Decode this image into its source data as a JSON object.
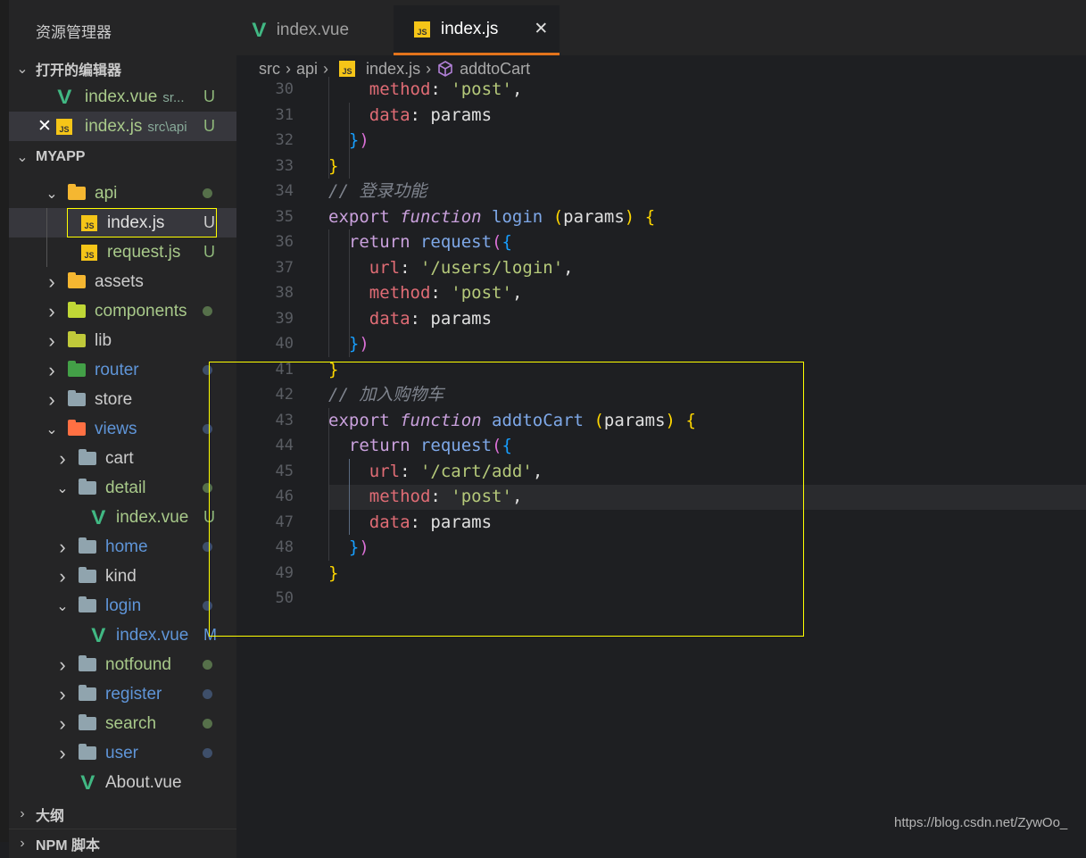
{
  "sidebar": {
    "title": "资源管理器",
    "open_editors_label": "打开的编辑器",
    "open_editors": [
      {
        "name": "index.vue",
        "path": "sr...",
        "status": "U",
        "icon": "vue-icon"
      },
      {
        "name": "index.js",
        "path": "src\\api",
        "status": "U",
        "icon": "js-icon",
        "active": true
      }
    ],
    "project_label": "MYAPP",
    "tree": [
      {
        "name": "api",
        "type": "folder",
        "open": true,
        "depth": 1,
        "color": "#f5b731",
        "text": "#a8c98a",
        "dot": "#56704a"
      },
      {
        "name": "index.js",
        "type": "js",
        "depth": 2,
        "text": "#e0e0e0",
        "status": "U",
        "statusColor": "#ccc",
        "selected": true
      },
      {
        "name": "request.js",
        "type": "js",
        "depth": 2,
        "text": "#a8c98a",
        "status": "U",
        "statusColor": "#8fb87a"
      },
      {
        "name": "assets",
        "type": "folder",
        "depth": 1,
        "color": "#f5b731",
        "text": "#ccc"
      },
      {
        "name": "components",
        "type": "folder",
        "depth": 1,
        "color": "#c0d736",
        "text": "#a8c98a",
        "dot": "#56704a"
      },
      {
        "name": "lib",
        "type": "folder",
        "depth": 1,
        "color": "#c0c93a",
        "text": "#ccc"
      },
      {
        "name": "router",
        "type": "folder",
        "depth": 1,
        "color": "#43a047",
        "text": "#5f95d8",
        "dot": "#3e4f6a"
      },
      {
        "name": "store",
        "type": "folder",
        "depth": 1,
        "color": "#90a4ae",
        "text": "#ccc"
      },
      {
        "name": "views",
        "type": "folder",
        "open": true,
        "depth": 1,
        "color": "#ff7043",
        "text": "#5f95d8",
        "dot": "#3e4f6a"
      },
      {
        "name": "cart",
        "type": "folder",
        "depth": 2,
        "color": "#90a4ae",
        "text": "#ccc"
      },
      {
        "name": "detail",
        "type": "folder",
        "open": true,
        "depth": 2,
        "color": "#90a4ae",
        "text": "#a8c98a",
        "dot": "#56704a"
      },
      {
        "name": "index.vue",
        "type": "vue",
        "depth": 3,
        "text": "#a8c98a",
        "status": "U",
        "statusColor": "#8fb87a"
      },
      {
        "name": "home",
        "type": "folder",
        "depth": 2,
        "color": "#90a4ae",
        "text": "#5f95d8",
        "dot": "#3e4f6a"
      },
      {
        "name": "kind",
        "type": "folder",
        "depth": 2,
        "color": "#90a4ae",
        "text": "#ccc"
      },
      {
        "name": "login",
        "type": "folder",
        "open": true,
        "depth": 2,
        "color": "#90a4ae",
        "text": "#5f95d8",
        "dot": "#3e4f6a"
      },
      {
        "name": "index.vue",
        "type": "vue",
        "depth": 3,
        "text": "#5f95d8",
        "status": "M",
        "statusColor": "#5f95d8"
      },
      {
        "name": "notfound",
        "type": "folder",
        "depth": 2,
        "color": "#90a4ae",
        "text": "#a8c98a",
        "dot": "#56704a"
      },
      {
        "name": "register",
        "type": "folder",
        "depth": 2,
        "color": "#90a4ae",
        "text": "#5f95d8",
        "dot": "#3e4f6a"
      },
      {
        "name": "search",
        "type": "folder",
        "depth": 2,
        "color": "#90a4ae",
        "text": "#a8c98a",
        "dot": "#56704a"
      },
      {
        "name": "user",
        "type": "folder",
        "depth": 2,
        "color": "#90a4ae",
        "text": "#5f95d8",
        "dot": "#3e4f6a"
      },
      {
        "name": "About.vue",
        "type": "vue",
        "depth": 2,
        "noChevron": true,
        "text": "#ccc"
      }
    ],
    "outline_label": "大纲",
    "npm_label": "NPM 脚本"
  },
  "tabs": [
    {
      "label": "index.vue",
      "icon": "vue-icon"
    },
    {
      "label": "index.js",
      "icon": "js-icon",
      "active": true,
      "close": "✕"
    }
  ],
  "breadcrumb": {
    "parts": [
      "src",
      "api",
      "index.js",
      "addtoCart"
    ],
    "sep": "›"
  },
  "editor": {
    "current_line": 46,
    "lines": [
      {
        "n": 30,
        "t": [
          [
            "    ",
            "p"
          ],
          [
            "method",
            "prop"
          ],
          [
            ": ",
            "punc"
          ],
          [
            "'post'",
            "str"
          ],
          [
            ",",
            "punc"
          ]
        ]
      },
      {
        "n": 31,
        "t": [
          [
            "    ",
            "p"
          ],
          [
            "data",
            "prop"
          ],
          [
            ": ",
            "punc"
          ],
          [
            "params",
            "p"
          ]
        ]
      },
      {
        "n": 32,
        "t": [
          [
            "  ",
            "p"
          ],
          [
            "}",
            "b3"
          ],
          [
            ")",
            "b2"
          ]
        ]
      },
      {
        "n": 33,
        "t": [
          [
            "}",
            "b1"
          ]
        ]
      },
      {
        "n": 34,
        "t": [
          [
            "// 登录功能",
            "cm"
          ]
        ]
      },
      {
        "n": 35,
        "t": [
          [
            "export ",
            "kw"
          ],
          [
            "function",
            "fn"
          ],
          [
            " ",
            "p"
          ],
          [
            "login",
            "name"
          ],
          [
            " ",
            "p"
          ],
          [
            "(",
            "b1"
          ],
          [
            "params",
            "p"
          ],
          [
            ")",
            "b1"
          ],
          [
            " ",
            "p"
          ],
          [
            "{",
            "b1"
          ]
        ]
      },
      {
        "n": 36,
        "t": [
          [
            "  ",
            "p"
          ],
          [
            "return ",
            "ret"
          ],
          [
            "request",
            "call"
          ],
          [
            "(",
            "b2"
          ],
          [
            "{",
            "b3"
          ]
        ]
      },
      {
        "n": 37,
        "t": [
          [
            "    ",
            "p"
          ],
          [
            "url",
            "prop"
          ],
          [
            ": ",
            "punc"
          ],
          [
            "'/users/login'",
            "str"
          ],
          [
            ",",
            "punc"
          ]
        ]
      },
      {
        "n": 38,
        "t": [
          [
            "    ",
            "p"
          ],
          [
            "method",
            "prop"
          ],
          [
            ": ",
            "punc"
          ],
          [
            "'post'",
            "str"
          ],
          [
            ",",
            "punc"
          ]
        ]
      },
      {
        "n": 39,
        "t": [
          [
            "    ",
            "p"
          ],
          [
            "data",
            "prop"
          ],
          [
            ": ",
            "punc"
          ],
          [
            "params",
            "p"
          ]
        ]
      },
      {
        "n": 40,
        "t": [
          [
            "  ",
            "p"
          ],
          [
            "}",
            "b3"
          ],
          [
            ")",
            "b2"
          ]
        ]
      },
      {
        "n": 41,
        "t": [
          [
            "}",
            "b1"
          ]
        ]
      },
      {
        "n": 42,
        "t": [
          [
            "// 加入购物车",
            "cm"
          ]
        ]
      },
      {
        "n": 43,
        "t": [
          [
            "export ",
            "kw"
          ],
          [
            "function",
            "fn"
          ],
          [
            " ",
            "p"
          ],
          [
            "addtoCart",
            "name"
          ],
          [
            " ",
            "p"
          ],
          [
            "(",
            "b1"
          ],
          [
            "params",
            "p"
          ],
          [
            ")",
            "b1"
          ],
          [
            " ",
            "p"
          ],
          [
            "{",
            "b1"
          ]
        ]
      },
      {
        "n": 44,
        "t": [
          [
            "  ",
            "p"
          ],
          [
            "return ",
            "ret"
          ],
          [
            "request",
            "call"
          ],
          [
            "(",
            "b2"
          ],
          [
            "{",
            "b3"
          ]
        ]
      },
      {
        "n": 45,
        "t": [
          [
            "    ",
            "p"
          ],
          [
            "url",
            "prop"
          ],
          [
            ": ",
            "punc"
          ],
          [
            "'/cart/add'",
            "str"
          ],
          [
            ",",
            "punc"
          ]
        ]
      },
      {
        "n": 46,
        "t": [
          [
            "    ",
            "p"
          ],
          [
            "method",
            "prop"
          ],
          [
            ": ",
            "punc"
          ],
          [
            "'post'",
            "str"
          ],
          [
            ",",
            "punc"
          ]
        ]
      },
      {
        "n": 47,
        "t": [
          [
            "    ",
            "p"
          ],
          [
            "data",
            "prop"
          ],
          [
            ": ",
            "punc"
          ],
          [
            "params",
            "p"
          ]
        ]
      },
      {
        "n": 48,
        "t": [
          [
            "  ",
            "p"
          ],
          [
            "}",
            "b3"
          ],
          [
            ")",
            "b2"
          ]
        ]
      },
      {
        "n": 49,
        "t": [
          [
            "}",
            "b1"
          ]
        ]
      },
      {
        "n": 50,
        "t": []
      }
    ]
  },
  "watermark": "https://blog.csdn.net/ZywOo_"
}
